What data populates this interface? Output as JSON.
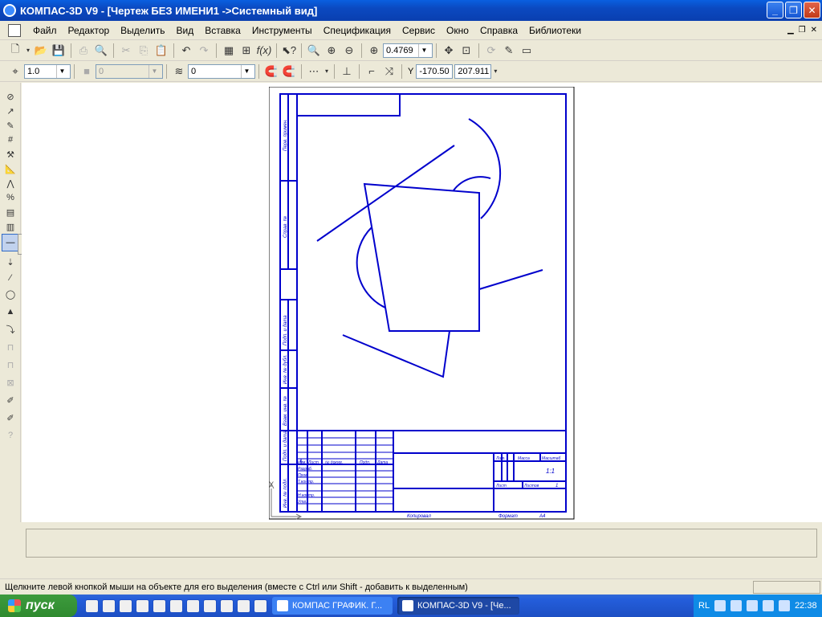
{
  "window": {
    "title": "КОМПАС-3D V9 - [Чертеж БЕЗ ИМЕНИ1 ->Системный вид]",
    "minimize_glyph": "_",
    "restore_glyph": "❐",
    "close_glyph": "✕"
  },
  "menu": {
    "items": [
      "Файл",
      "Редактор",
      "Выделить",
      "Вид",
      "Вставка",
      "Инструменты",
      "Спецификация",
      "Сервис",
      "Окно",
      "Справка",
      "Библиотеки"
    ]
  },
  "toolbar_standard": {
    "zoom_value": "0.4769"
  },
  "toolbar_current_state": {
    "step_value": "1.0",
    "style_value": "0",
    "layer_value": "0",
    "coord_label": "Y",
    "coord_x": "-170.50",
    "coord_y": "207.911"
  },
  "drawing": {
    "stamp_labels": {
      "perv_primen": "Перв. примен.",
      "sprav_no": "Справ. №",
      "podp_data_1": "Подп. и дата",
      "inv_dubl": "Инв. № дубл.",
      "vzam_inv": "Взам. инв. №",
      "podp_data_2": "Подп. и дата",
      "inv_podl": "Инв. № подл.",
      "izm": "Изм.",
      "list_col": "Лист",
      "ndokum": "№ докум.",
      "podp": "Подп.",
      "data": "Дата",
      "razrab": "Разраб.",
      "prov": "Пров.",
      "tkontr": "Т.контр.",
      "nkontr": "Н.контр.",
      "utv": "Утв.",
      "lit": "Лит.",
      "massa": "Масса",
      "masshtab": "Масштаб",
      "scale_value": "1:1",
      "list": "Лист",
      "listov": "Листов",
      "listov_value": "1",
      "kopiroval": "Копировал",
      "format": "Формат",
      "format_value": "А4"
    },
    "axis_y": "Y"
  },
  "status": {
    "message": "Щелкните левой кнопкой мыши на объекте для его выделения (вместе с Ctrl или Shift - добавить к выделенным)"
  },
  "taskbar": {
    "start_label": "пуск",
    "task1": "КОМПАС ГРАФИК. Г...",
    "task2": "КОМПАС-3D V9 - [Че...",
    "lang": "RL",
    "clock": "22:38"
  },
  "colors": {
    "drawing_blue": "#0000cc",
    "titlebar": "#0b49c0"
  }
}
